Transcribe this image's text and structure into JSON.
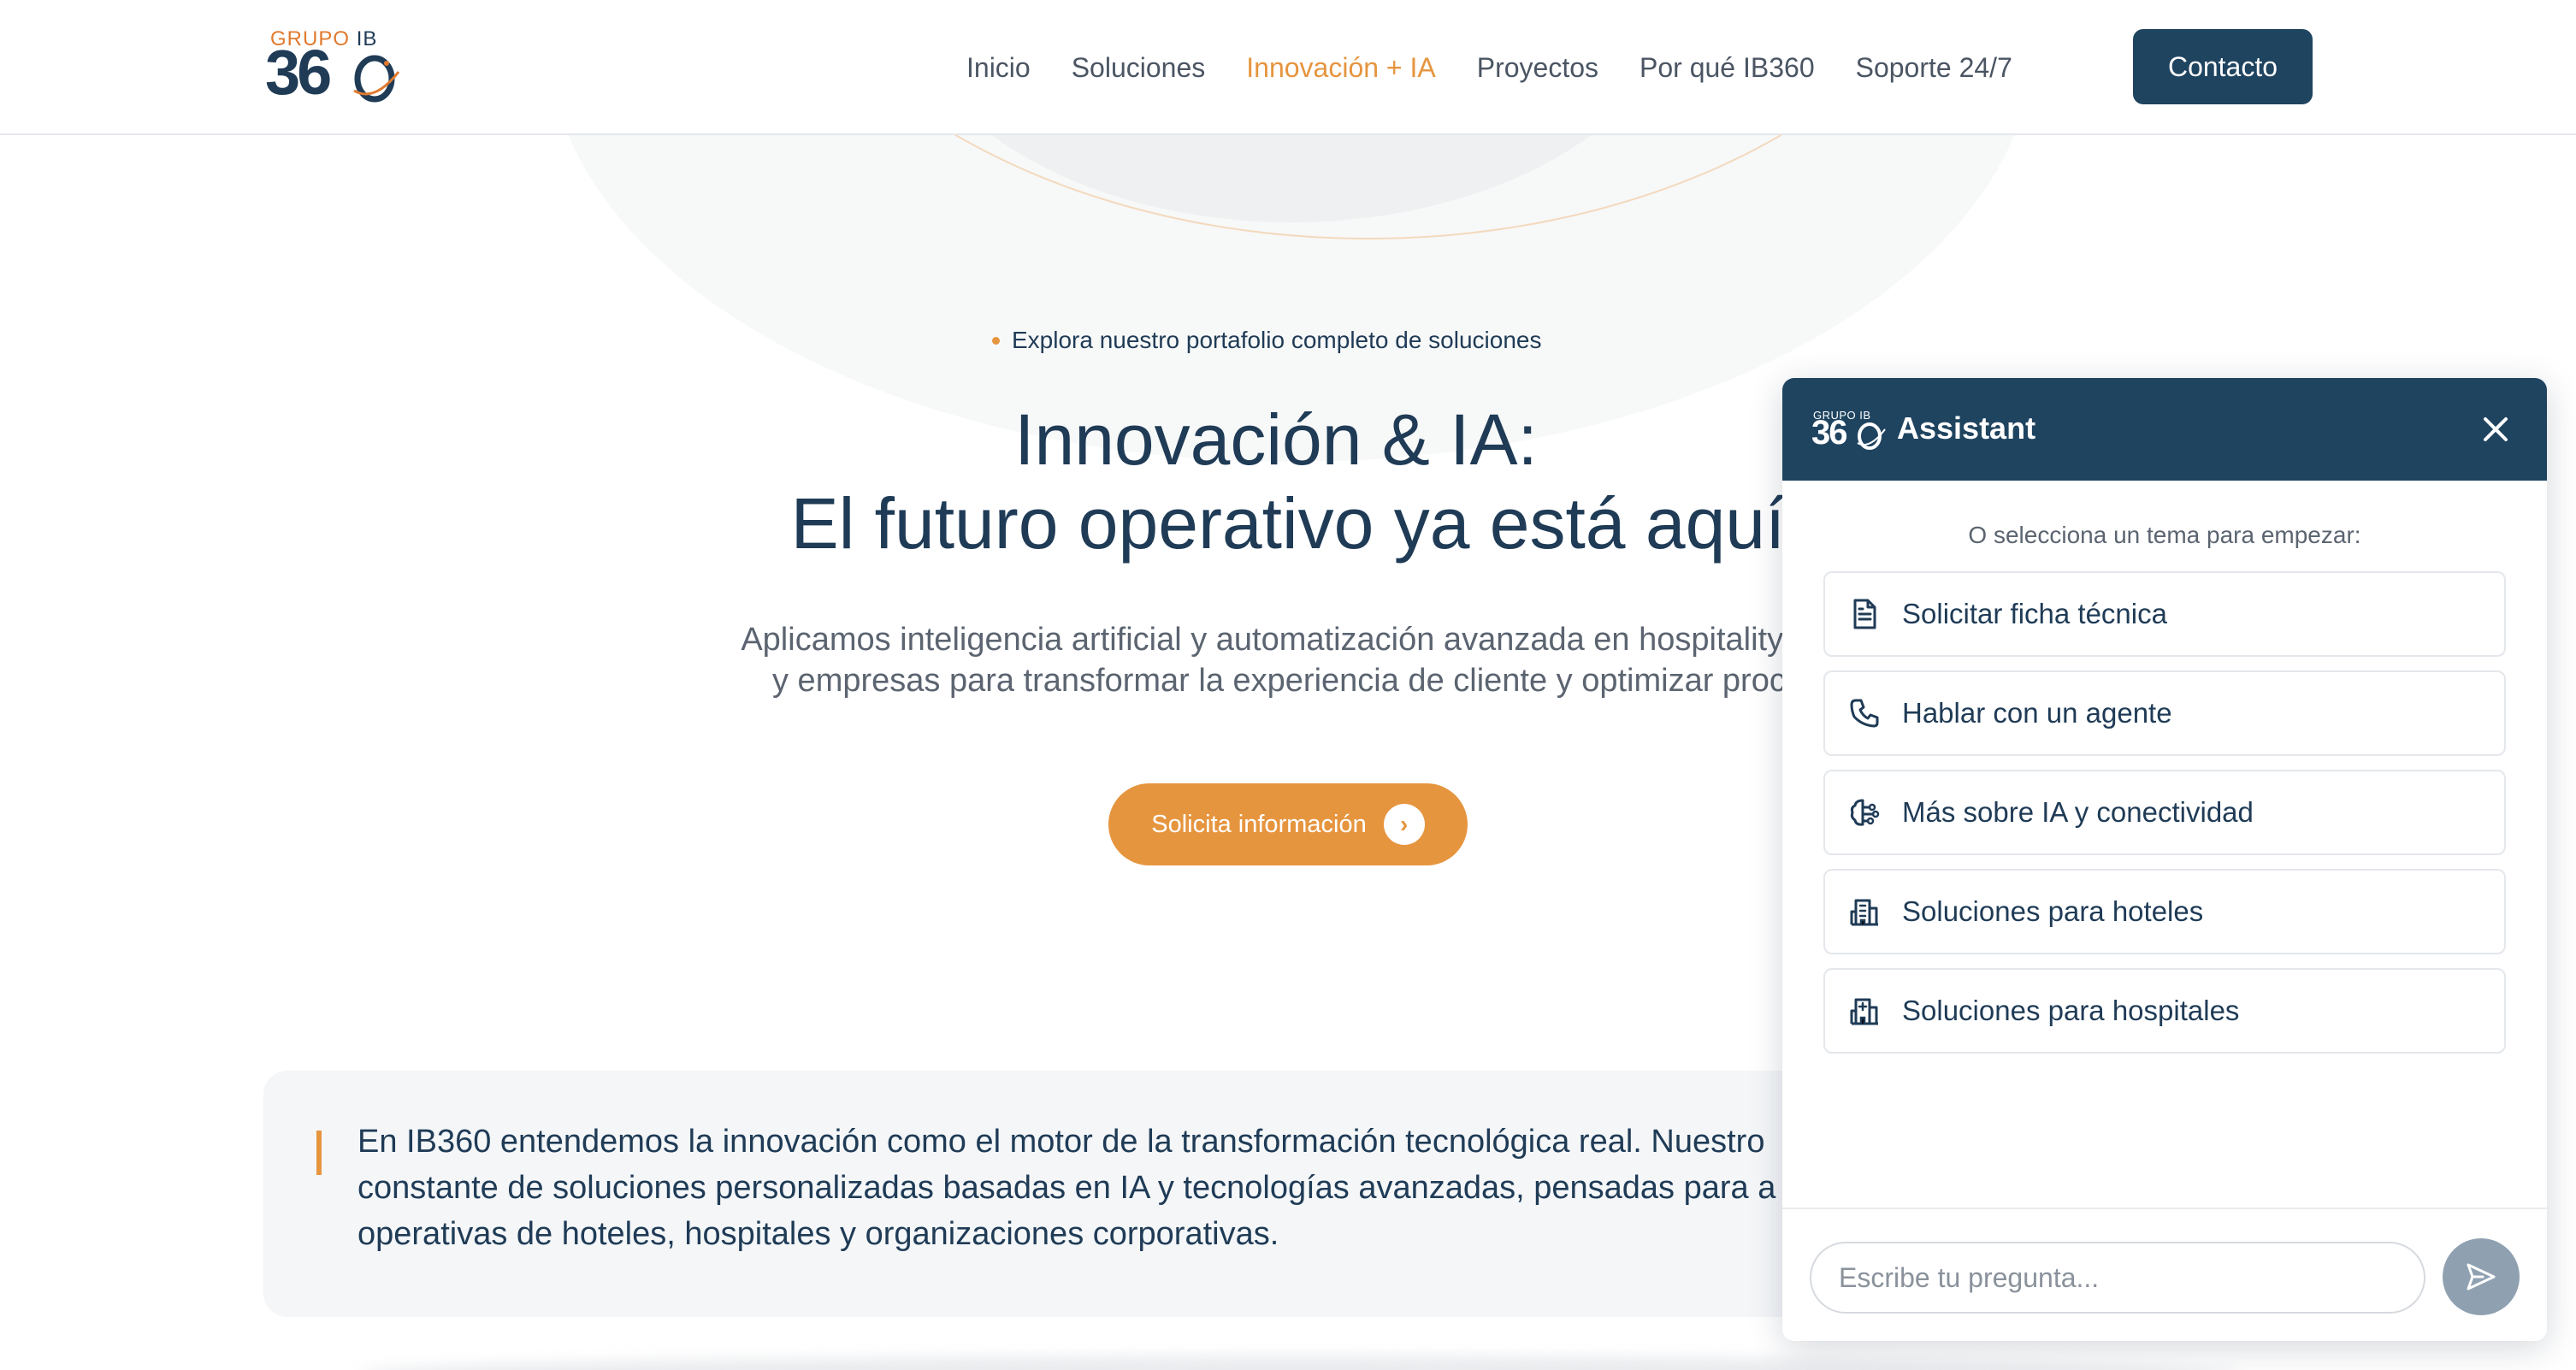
{
  "brand": {
    "logo_small": "GRUPO",
    "logo_small_ib": "IB",
    "logo_big": "36"
  },
  "nav": {
    "items": [
      {
        "label": "Inicio"
      },
      {
        "label": "Soluciones"
      },
      {
        "label": "Innovación + IA",
        "active": true
      },
      {
        "label": "Proyectos"
      },
      {
        "label": "Por qué IB360"
      },
      {
        "label": "Soporte 24/7"
      }
    ],
    "contact_label": "Contacto"
  },
  "hero": {
    "eyebrow": "Explora nuestro portafolio completo de soluciones",
    "title_line1": "Innovación & IA:",
    "title_line2": "El futuro operativo ya está aquí",
    "desc_line1": "Aplicamos inteligencia artificial y automatización avanzada en hospitality, he",
    "desc_line2": "y empresas para transformar la experiencia de cliente y optimizar proce",
    "cta_label": "Solicita información"
  },
  "quote": {
    "line1": "En IB360 entendemos la innovación como el motor de la transformación tecnológica real. Nuestro",
    "line2": "constante de soluciones personalizadas basadas en IA y tecnologías avanzadas, pensadas para a",
    "line3": "operativas de hoteles, hospitales y organizaciones corporativas."
  },
  "chat": {
    "logo_small": "GRUPO IB",
    "logo_big": "36",
    "title": "Assistant",
    "prompt": "O selecciona un tema para empezar:",
    "topics": [
      {
        "label": "Solicitar ficha técnica",
        "icon": "document-icon"
      },
      {
        "label": "Hablar con un agente",
        "icon": "phone-icon"
      },
      {
        "label": "Más sobre IA y conectividad",
        "icon": "brain-icon"
      },
      {
        "label": "Soluciones para hoteles",
        "icon": "hotel-icon"
      },
      {
        "label": "Soluciones para hospitales",
        "icon": "hospital-icon"
      }
    ],
    "input_placeholder": "Escribe tu pregunta..."
  },
  "colors": {
    "brand_navy": "#1f4460",
    "accent_orange": "#e6953f",
    "text_dark": "#1f3b56"
  }
}
